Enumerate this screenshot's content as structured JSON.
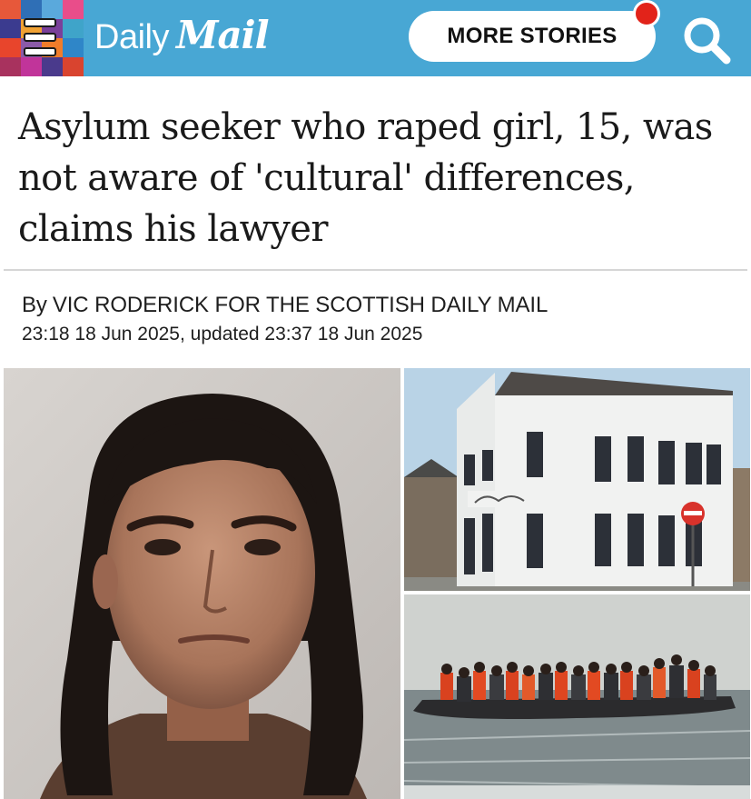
{
  "header": {
    "brand_daily": "Daily",
    "brand_mail": "Mail",
    "more_stories_label": "MORE STORIES",
    "accent_color": "#48a7d4",
    "notification_color": "#e2231a",
    "menu_icon": "hamburger-menu-icon",
    "search_icon": "search-icon"
  },
  "article": {
    "headline": "Asylum seeker who raped girl, 15, was not aware of 'cultural' differences, claims his lawyer",
    "byline_prefix": "By",
    "byline_author": "VIC RODERICK FOR THE SCOTTISH DAILY MAIL",
    "timestamp": "23:18 18 Jun 2025, updated 23:37 18 Jun 2025"
  }
}
